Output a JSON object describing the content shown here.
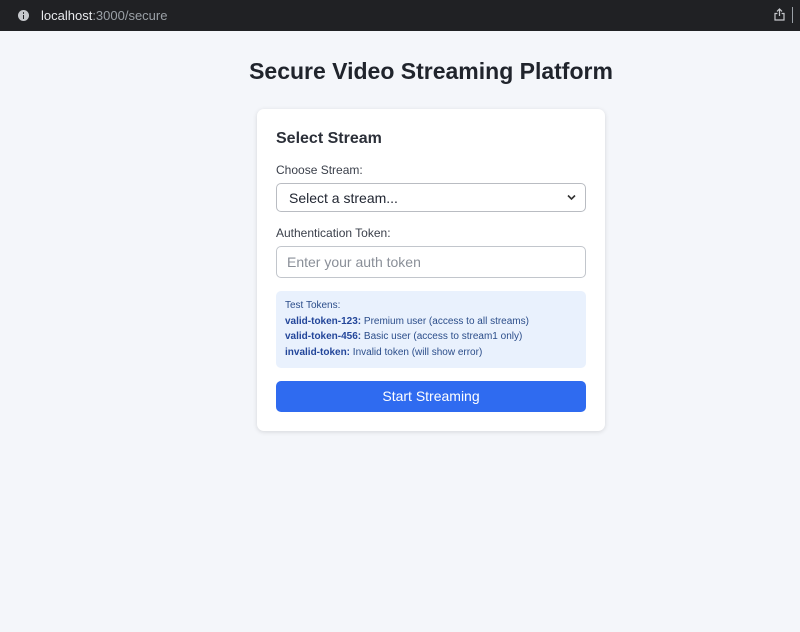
{
  "browser": {
    "url_host": "localhost",
    "url_path": ":3000/secure"
  },
  "page": {
    "title": "Secure Video Streaming Platform"
  },
  "card": {
    "title": "Select Stream",
    "stream_label": "Choose Stream:",
    "stream_select": {
      "selected": "Select a stream..."
    },
    "token_label": "Authentication Token:",
    "token_input": {
      "value": "",
      "placeholder": "Enter your auth token"
    },
    "test_tokens": {
      "heading": "Test Tokens:",
      "items": [
        {
          "token": "valid-token-123:",
          "description": " Premium user (access to all streams)"
        },
        {
          "token": "valid-token-456:",
          "description": " Basic user (access to stream1 only)"
        },
        {
          "token": "invalid-token:",
          "description": " Invalid token (will show error)"
        }
      ]
    },
    "start_button_label": "Start Streaming"
  },
  "icons": {
    "site_info": "info-icon",
    "share": "share-icon",
    "select_arrow": "chevron-down-icon"
  },
  "colors": {
    "accent": "#2f6bf0",
    "page_background": "#f4f6fa",
    "hint_background": "#e9f1fd",
    "browser_bar": "#202124"
  }
}
